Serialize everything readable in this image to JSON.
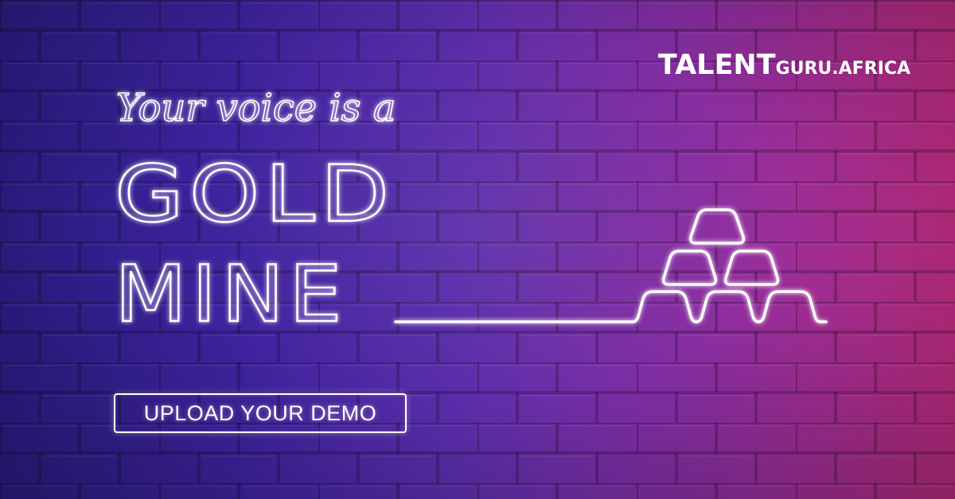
{
  "logo": {
    "talent": "TALENT",
    "guru": "GURU",
    "africa": ".AFRICA"
  },
  "headline": {
    "script_line": "Your voice is a",
    "line_1": "GOLD",
    "line_2": "MINE"
  },
  "cta": {
    "label": "UPLOAD YOUR DEMO"
  },
  "colors": {
    "gradient_left": "#2a1a8a",
    "gradient_right": "#c42a85",
    "neon": "#ffffff"
  },
  "icons": {
    "gold_bars": "gold-bars-stack-icon"
  }
}
